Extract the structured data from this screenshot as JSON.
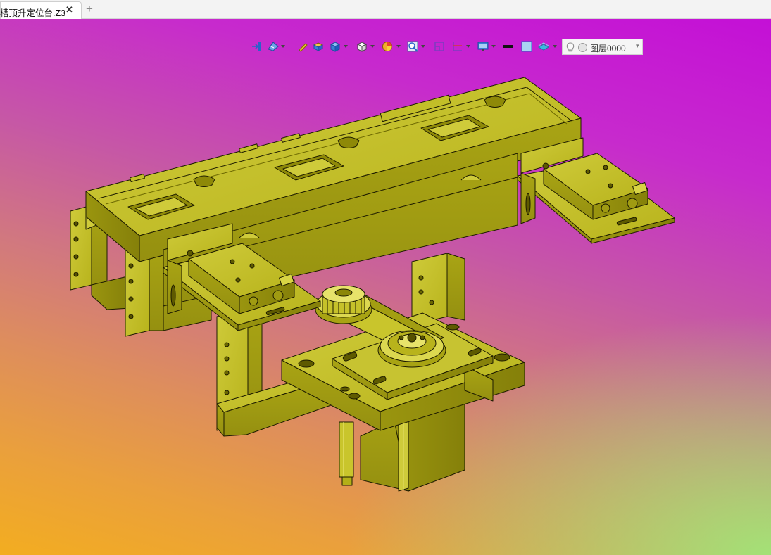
{
  "tab": {
    "title": "槽顶升定位台.Z3",
    "close_icon": "close-icon",
    "add_icon": "plus-icon"
  },
  "toolbar": {
    "buttons": [
      {
        "name": "exit-sketch-icon",
        "has_dropdown": false
      },
      {
        "name": "render-mode-icon",
        "has_dropdown": true
      },
      {
        "name": "pencil-icon",
        "has_dropdown": false
      },
      {
        "name": "solid-box-icon",
        "has_dropdown": false
      },
      {
        "name": "shaded-cube-icon",
        "has_dropdown": true
      },
      {
        "name": "view-cube-icon",
        "has_dropdown": true
      },
      {
        "name": "color-wheel-icon",
        "has_dropdown": true
      },
      {
        "name": "zoom-fit-icon",
        "has_dropdown": true
      },
      {
        "name": "section-view-icon",
        "has_dropdown": false
      },
      {
        "name": "clip-plane-icon",
        "has_dropdown": true
      },
      {
        "name": "display-monitor-icon",
        "has_dropdown": true
      },
      {
        "name": "line-color-icon",
        "has_dropdown": false
      },
      {
        "name": "face-color-icon",
        "has_dropdown": false
      },
      {
        "name": "layer-plane-icon",
        "has_dropdown": true
      }
    ],
    "layer_label": "图层0000"
  },
  "viewport": {
    "background_top": "#c410d6",
    "background_bottom": "#f3ad20",
    "background_corner": "#a0e678",
    "model_color": "#b3af18",
    "model_edge_color": "#1d1b00"
  }
}
